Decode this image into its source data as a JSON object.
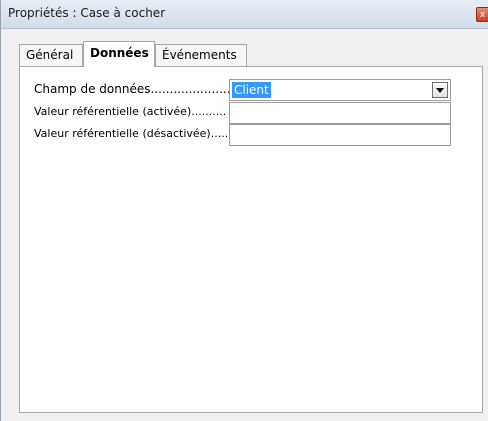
{
  "window": {
    "title": "Propriétés : Case à cocher",
    "close_glyph": "x"
  },
  "tabs": [
    {
      "label": "Général",
      "active": false
    },
    {
      "label": "Données",
      "active": true
    },
    {
      "label": "Événements",
      "active": false
    }
  ],
  "form": {
    "data_field": {
      "label": "Champ de données........................",
      "value": "Client",
      "icon": "chevron-down-icon"
    },
    "ref_on": {
      "label": "Valeur référentielle (activée)..........",
      "value": ""
    },
    "ref_off": {
      "label": "Valeur référentielle (désactivée).....",
      "value": ""
    }
  },
  "colors": {
    "selection": "#3399ff",
    "close_button": "#c24128"
  }
}
